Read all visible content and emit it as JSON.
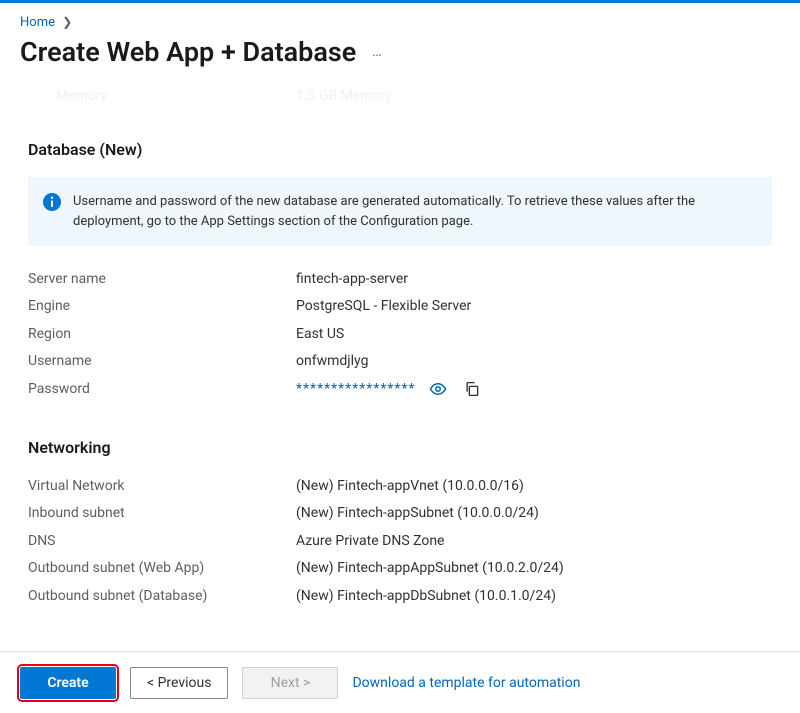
{
  "breadcrumb": {
    "home": "Home"
  },
  "page_title": "Create Web App + Database",
  "cutoff": {
    "label": "Memory",
    "value": "1.5 GB Memory"
  },
  "database": {
    "heading": "Database (New)",
    "info": "Username and password of the new database are generated automatically. To retrieve these values after the deployment, go to the App Settings section of the Configuration page.",
    "rows": {
      "server_name": {
        "label": "Server name",
        "value": "fintech-app-server"
      },
      "engine": {
        "label": "Engine",
        "value": "PostgreSQL - Flexible Server"
      },
      "region": {
        "label": "Region",
        "value": "East US"
      },
      "username": {
        "label": "Username",
        "value": "onfwmdjlyg"
      },
      "password": {
        "label": "Password",
        "value": "*****************"
      }
    }
  },
  "networking": {
    "heading": "Networking",
    "rows": {
      "vnet": {
        "label": "Virtual Network",
        "value": "(New) Fintech-appVnet (10.0.0.0/16)"
      },
      "inbound": {
        "label": "Inbound subnet",
        "value": "(New) Fintech-appSubnet (10.0.0.0/24)"
      },
      "dns": {
        "label": "DNS",
        "value": "Azure Private DNS Zone"
      },
      "out_web": {
        "label": "Outbound subnet (Web App)",
        "value": "(New) Fintech-appAppSubnet (10.0.2.0/24)"
      },
      "out_db": {
        "label": "Outbound subnet (Database)",
        "value": "(New) Fintech-appDbSubnet (10.0.1.0/24)"
      }
    }
  },
  "footer": {
    "create": "Create",
    "previous": "<  Previous",
    "next": "Next  >",
    "template_link": "Download a template for automation"
  }
}
